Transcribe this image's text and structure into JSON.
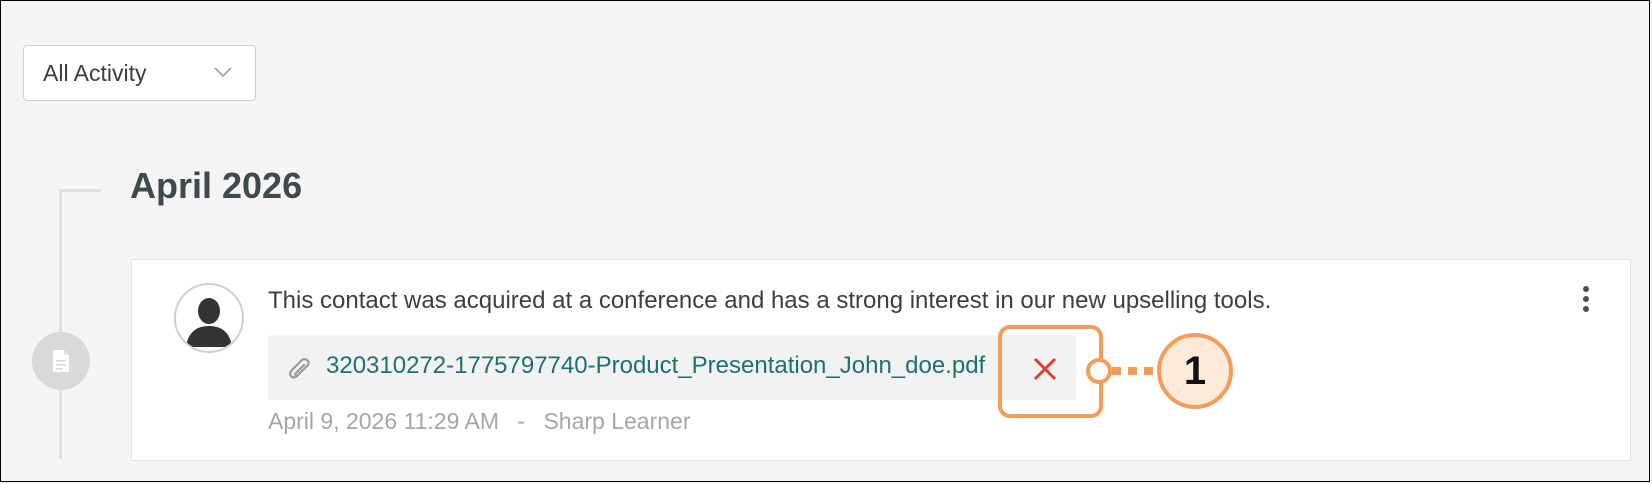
{
  "filter": {
    "selected": "All Activity",
    "icon": "chevron-down-icon"
  },
  "timeline": {
    "month_heading": "April 2026",
    "entry_icon": "document-icon"
  },
  "note": {
    "text": "This contact was acquired at a conference and has a strong interest in our new upselling tools.",
    "avatar_icon": "user-silhouette-icon",
    "menu_icon": "kebab-menu-icon",
    "attachment": {
      "icon": "paperclip-icon",
      "filename": "320310272-1775797740-Product_Presentation_John_doe.pdf",
      "delete_icon": "close-icon"
    },
    "meta": {
      "timestamp": "April 9, 2026 11:29 AM",
      "separator": "-",
      "author": "Sharp Learner"
    }
  },
  "callout": {
    "number": "1",
    "color": "#f39c5c"
  },
  "colors": {
    "link": "#1f7072",
    "delete": "#e23b30",
    "muted_text": "#a3a7ab"
  }
}
